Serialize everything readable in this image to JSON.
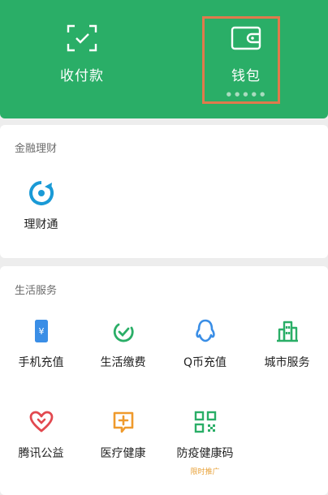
{
  "top": {
    "items": [
      {
        "label": "收付款",
        "icon": "scan-frame-icon"
      },
      {
        "label": "钱包",
        "icon": "wallet-icon"
      }
    ],
    "page_dots": "● ● ● ● ●",
    "highlight_color": "#e07a4c",
    "background": "#2aae67"
  },
  "finance": {
    "title": "金融理财",
    "items": [
      {
        "label": "理财通",
        "icon": "licaitong-icon"
      }
    ]
  },
  "services": {
    "title": "生活服务",
    "items": [
      {
        "label": "手机充值",
        "icon": "phone-recharge-icon"
      },
      {
        "label": "生活缴费",
        "icon": "utility-payment-icon"
      },
      {
        "label": "Q币充值",
        "icon": "qq-coin-icon"
      },
      {
        "label": "城市服务",
        "icon": "city-service-icon"
      },
      {
        "label": "腾讯公益",
        "icon": "charity-heart-icon"
      },
      {
        "label": "医疗健康",
        "icon": "medical-health-icon"
      },
      {
        "label": "防疫健康码",
        "icon": "qr-code-icon",
        "badge": "限时推广"
      }
    ]
  }
}
